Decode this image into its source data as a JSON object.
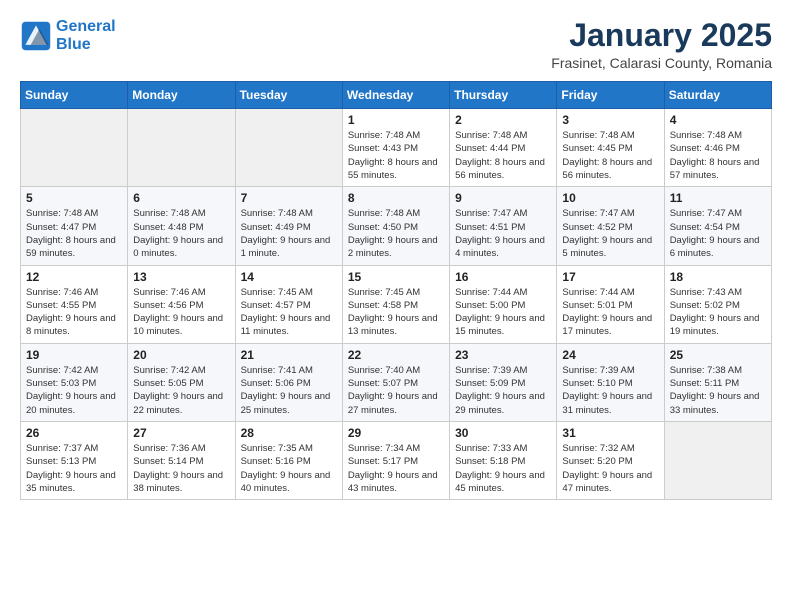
{
  "header": {
    "logo_line1": "General",
    "logo_line2": "Blue",
    "title": "January 2025",
    "subtitle": "Frasinet, Calarasi County, Romania"
  },
  "weekdays": [
    "Sunday",
    "Monday",
    "Tuesday",
    "Wednesday",
    "Thursday",
    "Friday",
    "Saturday"
  ],
  "weeks": [
    [
      {
        "num": "",
        "sunrise": "",
        "sunset": "",
        "daylight": "",
        "empty": true
      },
      {
        "num": "",
        "sunrise": "",
        "sunset": "",
        "daylight": "",
        "empty": true
      },
      {
        "num": "",
        "sunrise": "",
        "sunset": "",
        "daylight": "",
        "empty": true
      },
      {
        "num": "1",
        "sunrise": "7:48 AM",
        "sunset": "4:43 PM",
        "daylight": "8 hours and 55 minutes.",
        "empty": false
      },
      {
        "num": "2",
        "sunrise": "7:48 AM",
        "sunset": "4:44 PM",
        "daylight": "8 hours and 56 minutes.",
        "empty": false
      },
      {
        "num": "3",
        "sunrise": "7:48 AM",
        "sunset": "4:45 PM",
        "daylight": "8 hours and 56 minutes.",
        "empty": false
      },
      {
        "num": "4",
        "sunrise": "7:48 AM",
        "sunset": "4:46 PM",
        "daylight": "8 hours and 57 minutes.",
        "empty": false
      }
    ],
    [
      {
        "num": "5",
        "sunrise": "7:48 AM",
        "sunset": "4:47 PM",
        "daylight": "8 hours and 59 minutes.",
        "empty": false
      },
      {
        "num": "6",
        "sunrise": "7:48 AM",
        "sunset": "4:48 PM",
        "daylight": "9 hours and 0 minutes.",
        "empty": false
      },
      {
        "num": "7",
        "sunrise": "7:48 AM",
        "sunset": "4:49 PM",
        "daylight": "9 hours and 1 minute.",
        "empty": false
      },
      {
        "num": "8",
        "sunrise": "7:48 AM",
        "sunset": "4:50 PM",
        "daylight": "9 hours and 2 minutes.",
        "empty": false
      },
      {
        "num": "9",
        "sunrise": "7:47 AM",
        "sunset": "4:51 PM",
        "daylight": "9 hours and 4 minutes.",
        "empty": false
      },
      {
        "num": "10",
        "sunrise": "7:47 AM",
        "sunset": "4:52 PM",
        "daylight": "9 hours and 5 minutes.",
        "empty": false
      },
      {
        "num": "11",
        "sunrise": "7:47 AM",
        "sunset": "4:54 PM",
        "daylight": "9 hours and 6 minutes.",
        "empty": false
      }
    ],
    [
      {
        "num": "12",
        "sunrise": "7:46 AM",
        "sunset": "4:55 PM",
        "daylight": "9 hours and 8 minutes.",
        "empty": false
      },
      {
        "num": "13",
        "sunrise": "7:46 AM",
        "sunset": "4:56 PM",
        "daylight": "9 hours and 10 minutes.",
        "empty": false
      },
      {
        "num": "14",
        "sunrise": "7:45 AM",
        "sunset": "4:57 PM",
        "daylight": "9 hours and 11 minutes.",
        "empty": false
      },
      {
        "num": "15",
        "sunrise": "7:45 AM",
        "sunset": "4:58 PM",
        "daylight": "9 hours and 13 minutes.",
        "empty": false
      },
      {
        "num": "16",
        "sunrise": "7:44 AM",
        "sunset": "5:00 PM",
        "daylight": "9 hours and 15 minutes.",
        "empty": false
      },
      {
        "num": "17",
        "sunrise": "7:44 AM",
        "sunset": "5:01 PM",
        "daylight": "9 hours and 17 minutes.",
        "empty": false
      },
      {
        "num": "18",
        "sunrise": "7:43 AM",
        "sunset": "5:02 PM",
        "daylight": "9 hours and 19 minutes.",
        "empty": false
      }
    ],
    [
      {
        "num": "19",
        "sunrise": "7:42 AM",
        "sunset": "5:03 PM",
        "daylight": "9 hours and 20 minutes.",
        "empty": false
      },
      {
        "num": "20",
        "sunrise": "7:42 AM",
        "sunset": "5:05 PM",
        "daylight": "9 hours and 22 minutes.",
        "empty": false
      },
      {
        "num": "21",
        "sunrise": "7:41 AM",
        "sunset": "5:06 PM",
        "daylight": "9 hours and 25 minutes.",
        "empty": false
      },
      {
        "num": "22",
        "sunrise": "7:40 AM",
        "sunset": "5:07 PM",
        "daylight": "9 hours and 27 minutes.",
        "empty": false
      },
      {
        "num": "23",
        "sunrise": "7:39 AM",
        "sunset": "5:09 PM",
        "daylight": "9 hours and 29 minutes.",
        "empty": false
      },
      {
        "num": "24",
        "sunrise": "7:39 AM",
        "sunset": "5:10 PM",
        "daylight": "9 hours and 31 minutes.",
        "empty": false
      },
      {
        "num": "25",
        "sunrise": "7:38 AM",
        "sunset": "5:11 PM",
        "daylight": "9 hours and 33 minutes.",
        "empty": false
      }
    ],
    [
      {
        "num": "26",
        "sunrise": "7:37 AM",
        "sunset": "5:13 PM",
        "daylight": "9 hours and 35 minutes.",
        "empty": false
      },
      {
        "num": "27",
        "sunrise": "7:36 AM",
        "sunset": "5:14 PM",
        "daylight": "9 hours and 38 minutes.",
        "empty": false
      },
      {
        "num": "28",
        "sunrise": "7:35 AM",
        "sunset": "5:16 PM",
        "daylight": "9 hours and 40 minutes.",
        "empty": false
      },
      {
        "num": "29",
        "sunrise": "7:34 AM",
        "sunset": "5:17 PM",
        "daylight": "9 hours and 43 minutes.",
        "empty": false
      },
      {
        "num": "30",
        "sunrise": "7:33 AM",
        "sunset": "5:18 PM",
        "daylight": "9 hours and 45 minutes.",
        "empty": false
      },
      {
        "num": "31",
        "sunrise": "7:32 AM",
        "sunset": "5:20 PM",
        "daylight": "9 hours and 47 minutes.",
        "empty": false
      },
      {
        "num": "",
        "sunrise": "",
        "sunset": "",
        "daylight": "",
        "empty": true
      }
    ]
  ]
}
